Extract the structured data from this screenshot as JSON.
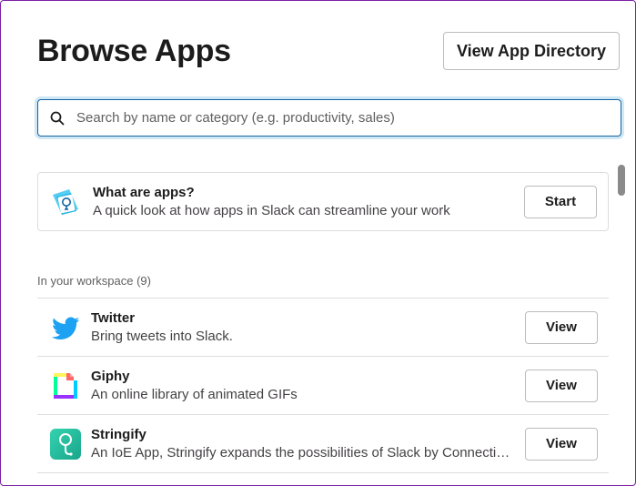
{
  "header": {
    "title": "Browse Apps",
    "directory_button": "View App Directory"
  },
  "search": {
    "placeholder": "Search by name or category (e.g. productivity, sales)",
    "value": "",
    "icon": "search-icon"
  },
  "intro_card": {
    "title": "What are apps?",
    "description": "A quick look at how apps in Slack can streamline your work",
    "button": "Start",
    "icon": "lightbulb-icon"
  },
  "workspace": {
    "label": "In your workspace (9)",
    "apps": [
      {
        "name": "Twitter",
        "description": "Bring tweets into Slack.",
        "button": "View",
        "icon": "twitter-bird-icon",
        "color": "#1da1f2"
      },
      {
        "name": "Giphy",
        "description": "An online library of animated GIFs",
        "button": "View",
        "icon": "giphy-icon",
        "color": "#00d8ff"
      },
      {
        "name": "Stringify",
        "description": "An IoE App, Stringify expands the possibilities of Slack by Connecting everything",
        "button": "View",
        "icon": "stringify-icon",
        "color": "#2ebf9f"
      }
    ]
  },
  "colors": {
    "accent": "#1264a3",
    "border": "#dddddd",
    "text": "#1d1c1d"
  }
}
